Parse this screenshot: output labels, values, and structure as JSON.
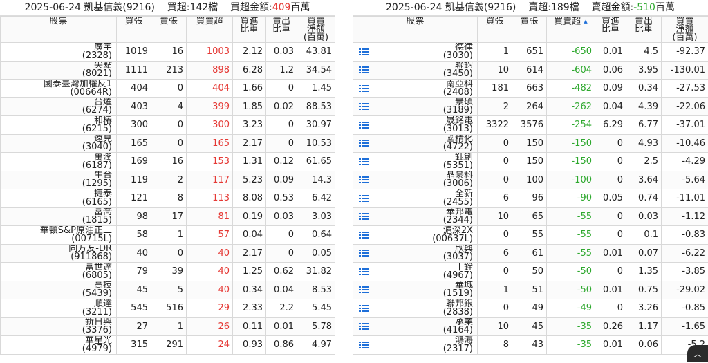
{
  "left": {
    "title_prefix": "2025-06-24 凱基信義(9216)",
    "count_label": "買超:142檔",
    "amount_label": "買超金額:",
    "amount_value": "409",
    "amount_unit": "百萬",
    "headers": {
      "stock": "股票",
      "buy": "買張",
      "sell": "賣張",
      "net": "買賣超",
      "buy_ratio_1": "買進",
      "buy_ratio_2": "比重",
      "sell_ratio_1": "賣出",
      "sell_ratio_2": "比重",
      "amount_1": "買賣",
      "amount_2": "淨額",
      "amount_3": "(百萬)"
    },
    "rows": [
      {
        "name": "廣宇",
        "code": "(2328)",
        "buy": "1019",
        "sell": "16",
        "net": "1003",
        "br": "2.12",
        "sr": "0.03",
        "amt": "43.81"
      },
      {
        "name": "尖點",
        "code": "(8021)",
        "buy": "1111",
        "sell": "213",
        "net": "898",
        "br": "6.28",
        "sr": "1.2",
        "amt": "34.54"
      },
      {
        "name": "國泰臺灣加權反1",
        "code": "(00664R)",
        "buy": "404",
        "sell": "0",
        "net": "404",
        "br": "1.66",
        "sr": "0",
        "amt": "1.45"
      },
      {
        "name": "台燿",
        "code": "(6274)",
        "buy": "403",
        "sell": "4",
        "net": "399",
        "br": "1.85",
        "sr": "0.02",
        "amt": "88.53"
      },
      {
        "name": "和椿",
        "code": "(6215)",
        "buy": "300",
        "sell": "0",
        "net": "300",
        "br": "3.23",
        "sr": "0",
        "amt": "30.97"
      },
      {
        "name": "遠見",
        "code": "(3040)",
        "buy": "165",
        "sell": "0",
        "net": "165",
        "br": "2.17",
        "sr": "0",
        "amt": "10.53"
      },
      {
        "name": "萬潤",
        "code": "(6187)",
        "buy": "169",
        "sell": "16",
        "net": "153",
        "br": "1.31",
        "sr": "0.12",
        "amt": "61.65"
      },
      {
        "name": "生合",
        "code": "(1295)",
        "buy": "119",
        "sell": "2",
        "net": "117",
        "br": "5.23",
        "sr": "0.09",
        "amt": "14.3"
      },
      {
        "name": "捷泰",
        "code": "(6165)",
        "buy": "121",
        "sell": "8",
        "net": "113",
        "br": "8.08",
        "sr": "0.53",
        "amt": "6.42"
      },
      {
        "name": "富喬",
        "code": "(1815)",
        "buy": "98",
        "sell": "17",
        "net": "81",
        "br": "0.19",
        "sr": "0.03",
        "amt": "3.03"
      },
      {
        "name": "華頓S&P原油正二",
        "code": "(00715L)",
        "buy": "58",
        "sell": "1",
        "net": "57",
        "br": "0.04",
        "sr": "0",
        "amt": "0.64"
      },
      {
        "name": "同方友-DR",
        "code": "(911868)",
        "buy": "40",
        "sell": "0",
        "net": "40",
        "br": "2.17",
        "sr": "0",
        "amt": "0.05"
      },
      {
        "name": "富世達",
        "code": "(6805)",
        "buy": "79",
        "sell": "39",
        "net": "40",
        "br": "1.25",
        "sr": "0.62",
        "amt": "31.82"
      },
      {
        "name": "高技",
        "code": "(5439)",
        "buy": "45",
        "sell": "5",
        "net": "40",
        "br": "0.34",
        "sr": "0.04",
        "amt": "8.53"
      },
      {
        "name": "順達",
        "code": "(3211)",
        "buy": "545",
        "sell": "516",
        "net": "29",
        "br": "2.33",
        "sr": "2.2",
        "amt": "5.45"
      },
      {
        "name": "新日興",
        "code": "(3376)",
        "buy": "27",
        "sell": "1",
        "net": "26",
        "br": "0.11",
        "sr": "0.01",
        "amt": "5.78"
      },
      {
        "name": "華星光",
        "code": "(4979)",
        "buy": "315",
        "sell": "291",
        "net": "24",
        "br": "0.93",
        "sr": "0.86",
        "amt": "4.97"
      }
    ]
  },
  "right": {
    "title_prefix": "2025-06-24 凱基信義(9216)",
    "count_label": "賣超:189檔",
    "amount_label": "賣超金額:",
    "amount_value": "-510",
    "amount_unit": "百萬",
    "headers": {
      "stock": "股票",
      "buy": "買張",
      "sell": "賣張",
      "net": "買賣超",
      "buy_ratio_1": "買進",
      "buy_ratio_2": "比重",
      "sell_ratio_1": "賣出",
      "sell_ratio_2": "比重",
      "amount_1": "買賣",
      "amount_2": "淨額",
      "amount_3": "(百萬)"
    },
    "rows": [
      {
        "name": "德律",
        "code": "(3030)",
        "buy": "1",
        "sell": "651",
        "net": "-650",
        "br": "0.01",
        "sr": "4.5",
        "amt": "-92.37"
      },
      {
        "name": "聯鈞",
        "code": "(3450)",
        "buy": "10",
        "sell": "614",
        "net": "-604",
        "br": "0.06",
        "sr": "3.95",
        "amt": "-130.01"
      },
      {
        "name": "南亞科",
        "code": "(2408)",
        "buy": "181",
        "sell": "663",
        "net": "-482",
        "br": "0.09",
        "sr": "0.34",
        "amt": "-27.53"
      },
      {
        "name": "景碩",
        "code": "(3189)",
        "buy": "2",
        "sell": "264",
        "net": "-262",
        "br": "0.04",
        "sr": "4.39",
        "amt": "-22.06"
      },
      {
        "name": "晟銘電",
        "code": "(3013)",
        "buy": "3322",
        "sell": "3576",
        "net": "-254",
        "br": "6.29",
        "sr": "6.77",
        "amt": "-37.01"
      },
      {
        "name": "國精化",
        "code": "(4722)",
        "buy": "0",
        "sell": "150",
        "net": "-150",
        "br": "0",
        "sr": "4.93",
        "amt": "-10.46"
      },
      {
        "name": "鈺創",
        "code": "(5351)",
        "buy": "0",
        "sell": "150",
        "net": "-150",
        "br": "0",
        "sr": "2.5",
        "amt": "-4.29"
      },
      {
        "name": "晶豪科",
        "code": "(3006)",
        "buy": "0",
        "sell": "100",
        "net": "-100",
        "br": "0",
        "sr": "3.64",
        "amt": "-5.64"
      },
      {
        "name": "全新",
        "code": "(2455)",
        "buy": "6",
        "sell": "96",
        "net": "-90",
        "br": "0.05",
        "sr": "0.74",
        "amt": "-11.01"
      },
      {
        "name": "華邦電",
        "code": "(2344)",
        "buy": "10",
        "sell": "65",
        "net": "-55",
        "br": "0",
        "sr": "0.03",
        "amt": "-1.12"
      },
      {
        "name": "滬深2X",
        "code": "(00637L)",
        "buy": "0",
        "sell": "55",
        "net": "-55",
        "br": "0",
        "sr": "0.1",
        "amt": "-0.83"
      },
      {
        "name": "欣興",
        "code": "(3037)",
        "buy": "6",
        "sell": "61",
        "net": "-55",
        "br": "0.01",
        "sr": "0.07",
        "amt": "-6.22"
      },
      {
        "name": "十銓",
        "code": "(4967)",
        "buy": "0",
        "sell": "50",
        "net": "-50",
        "br": "0",
        "sr": "1.35",
        "amt": "-3.85"
      },
      {
        "name": "華城",
        "code": "(1519)",
        "buy": "1",
        "sell": "51",
        "net": "-50",
        "br": "0.01",
        "sr": "0.75",
        "amt": "-29.02"
      },
      {
        "name": "聯邦銀",
        "code": "(2838)",
        "buy": "0",
        "sell": "49",
        "net": "-49",
        "br": "0",
        "sr": "3.26",
        "amt": "-0.85"
      },
      {
        "name": "承業",
        "code": "(4164)",
        "buy": "10",
        "sell": "45",
        "net": "-35",
        "br": "0.26",
        "sr": "1.17",
        "amt": "-1.65"
      },
      {
        "name": "鴻海",
        "code": "(2317)",
        "buy": "8",
        "sell": "43",
        "net": "-35",
        "br": "0.01",
        "sr": "0.06",
        "amt": "-5.2"
      }
    ]
  },
  "colors": {
    "positive": "#e53935",
    "negative": "#2ea82e",
    "icon": "#1e6fd9"
  },
  "icons": {
    "row_menu": "list-icon",
    "sort": "sort-arrow-icon",
    "scroll_top": "chevron-up-icon"
  },
  "scroll_top_glyph": "︿"
}
